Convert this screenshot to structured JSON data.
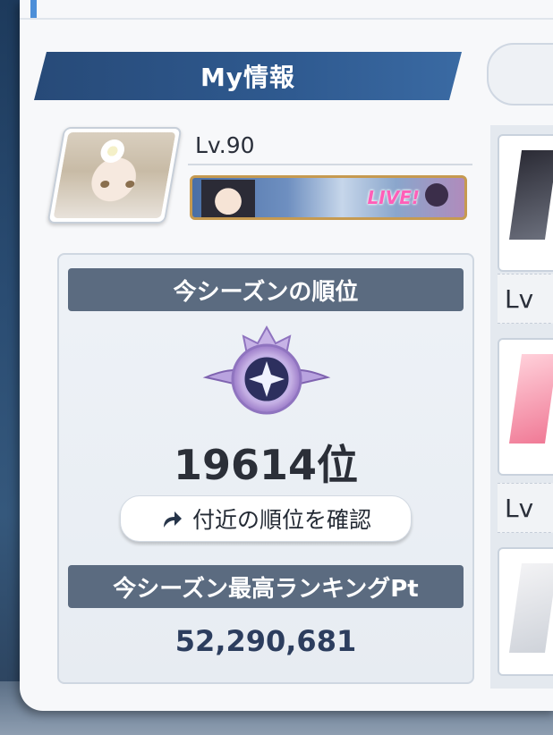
{
  "panel": {
    "title": "My情報"
  },
  "profile": {
    "level_text": "Lv.90",
    "name_plate_logo": "LIVE!"
  },
  "season": {
    "rank_header": "今シーズンの順位",
    "rank_value": "19614位",
    "nearby_button_label": "付近の順位を確認",
    "best_header": "今シーズン最高ランキングPt",
    "best_value": "52,290,681"
  },
  "side_list": {
    "level_labels": [
      "Lv",
      "Lv"
    ]
  },
  "icons": {
    "nearby": "curved-arrow-icon",
    "emblem": "rank-emblem-icon"
  },
  "colors": {
    "title_bar": "#274a78",
    "section_header": "#5b6b80",
    "points_text": "#2c3d5e"
  }
}
